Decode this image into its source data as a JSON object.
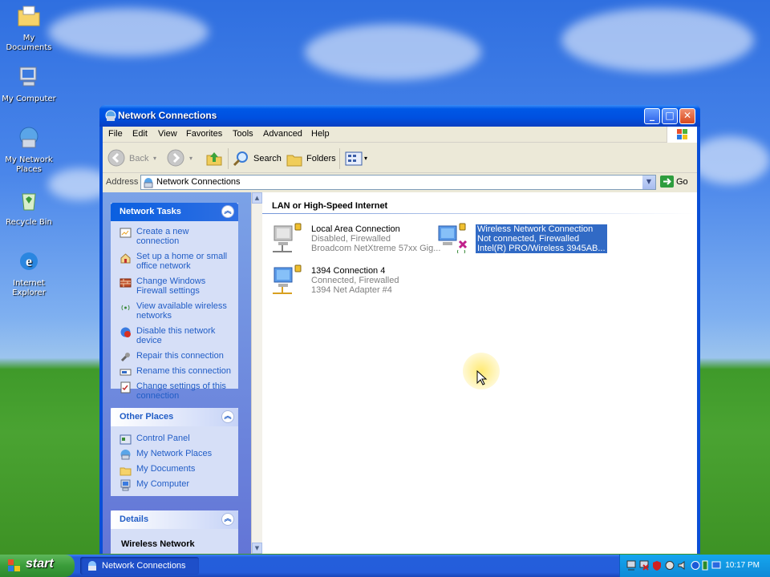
{
  "desktop": {
    "icons": [
      {
        "label": "My Documents"
      },
      {
        "label": "My Computer"
      },
      {
        "label": "My Network Places"
      },
      {
        "label": "Recycle Bin"
      },
      {
        "label": "Internet Explorer"
      }
    ]
  },
  "window": {
    "title": "Network Connections",
    "menu": [
      "File",
      "Edit",
      "View",
      "Favorites",
      "Tools",
      "Advanced",
      "Help"
    ],
    "toolbar": {
      "back": "Back",
      "search": "Search",
      "folders": "Folders"
    },
    "address": {
      "label": "Address",
      "value": "Network Connections",
      "go": "Go"
    },
    "taskpane": {
      "network_tasks": {
        "title": "Network Tasks",
        "items": [
          "Create a new connection",
          "Set up a home or small office network",
          "Change Windows Firewall settings",
          "View available wireless networks",
          "Disable this network device",
          "Repair this connection",
          "Rename this connection",
          "Change settings of this connection"
        ]
      },
      "other_places": {
        "title": "Other Places",
        "items": [
          "Control Panel",
          "My Network Places",
          "My Documents",
          "My Computer"
        ]
      },
      "details": {
        "title": "Details",
        "heading": "Wireless Network"
      }
    },
    "main": {
      "group_header": "LAN or High-Speed Internet",
      "connections": [
        {
          "name": "Local Area Connection",
          "status": "Disabled, Firewalled",
          "device": "Broadcom NetXtreme 57xx Gig..."
        },
        {
          "name": "Wireless Network Connection",
          "status": "Not connected, Firewalled",
          "device": "Intel(R) PRO/Wireless 3945AB..."
        },
        {
          "name": "1394 Connection 4",
          "status": "Connected, Firewalled",
          "device": "1394 Net Adapter #4"
        }
      ]
    }
  },
  "taskbar": {
    "start": "start",
    "task": "Network Connections",
    "clock": "10:17 PM"
  }
}
